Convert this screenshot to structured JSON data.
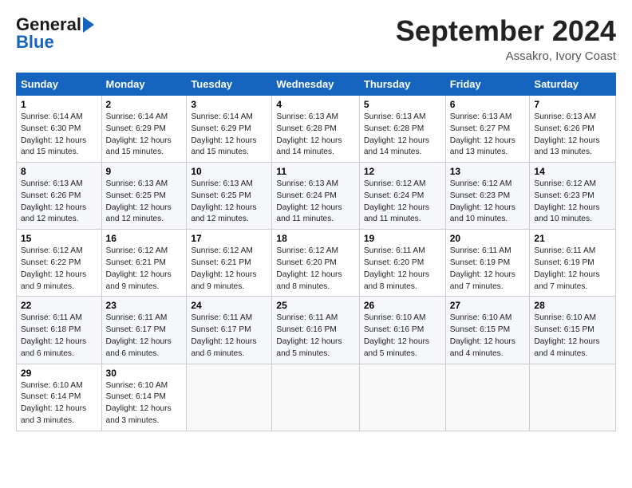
{
  "logo": {
    "line1": "General",
    "line2": "Blue",
    "arrow": true
  },
  "header": {
    "month": "September 2024",
    "location": "Assakro, Ivory Coast"
  },
  "days_of_week": [
    "Sunday",
    "Monday",
    "Tuesday",
    "Wednesday",
    "Thursday",
    "Friday",
    "Saturday"
  ],
  "weeks": [
    [
      {
        "day": "1",
        "sunrise": "6:14 AM",
        "sunset": "6:30 PM",
        "daylight": "12 hours and 15 minutes."
      },
      {
        "day": "2",
        "sunrise": "6:14 AM",
        "sunset": "6:29 PM",
        "daylight": "12 hours and 15 minutes."
      },
      {
        "day": "3",
        "sunrise": "6:14 AM",
        "sunset": "6:29 PM",
        "daylight": "12 hours and 15 minutes."
      },
      {
        "day": "4",
        "sunrise": "6:13 AM",
        "sunset": "6:28 PM",
        "daylight": "12 hours and 14 minutes."
      },
      {
        "day": "5",
        "sunrise": "6:13 AM",
        "sunset": "6:28 PM",
        "daylight": "12 hours and 14 minutes."
      },
      {
        "day": "6",
        "sunrise": "6:13 AM",
        "sunset": "6:27 PM",
        "daylight": "12 hours and 13 minutes."
      },
      {
        "day": "7",
        "sunrise": "6:13 AM",
        "sunset": "6:26 PM",
        "daylight": "12 hours and 13 minutes."
      }
    ],
    [
      {
        "day": "8",
        "sunrise": "6:13 AM",
        "sunset": "6:26 PM",
        "daylight": "12 hours and 12 minutes."
      },
      {
        "day": "9",
        "sunrise": "6:13 AM",
        "sunset": "6:25 PM",
        "daylight": "12 hours and 12 minutes."
      },
      {
        "day": "10",
        "sunrise": "6:13 AM",
        "sunset": "6:25 PM",
        "daylight": "12 hours and 12 minutes."
      },
      {
        "day": "11",
        "sunrise": "6:13 AM",
        "sunset": "6:24 PM",
        "daylight": "12 hours and 11 minutes."
      },
      {
        "day": "12",
        "sunrise": "6:12 AM",
        "sunset": "6:24 PM",
        "daylight": "12 hours and 11 minutes."
      },
      {
        "day": "13",
        "sunrise": "6:12 AM",
        "sunset": "6:23 PM",
        "daylight": "12 hours and 10 minutes."
      },
      {
        "day": "14",
        "sunrise": "6:12 AM",
        "sunset": "6:23 PM",
        "daylight": "12 hours and 10 minutes."
      }
    ],
    [
      {
        "day": "15",
        "sunrise": "6:12 AM",
        "sunset": "6:22 PM",
        "daylight": "12 hours and 9 minutes."
      },
      {
        "day": "16",
        "sunrise": "6:12 AM",
        "sunset": "6:21 PM",
        "daylight": "12 hours and 9 minutes."
      },
      {
        "day": "17",
        "sunrise": "6:12 AM",
        "sunset": "6:21 PM",
        "daylight": "12 hours and 9 minutes."
      },
      {
        "day": "18",
        "sunrise": "6:12 AM",
        "sunset": "6:20 PM",
        "daylight": "12 hours and 8 minutes."
      },
      {
        "day": "19",
        "sunrise": "6:11 AM",
        "sunset": "6:20 PM",
        "daylight": "12 hours and 8 minutes."
      },
      {
        "day": "20",
        "sunrise": "6:11 AM",
        "sunset": "6:19 PM",
        "daylight": "12 hours and 7 minutes."
      },
      {
        "day": "21",
        "sunrise": "6:11 AM",
        "sunset": "6:19 PM",
        "daylight": "12 hours and 7 minutes."
      }
    ],
    [
      {
        "day": "22",
        "sunrise": "6:11 AM",
        "sunset": "6:18 PM",
        "daylight": "12 hours and 6 minutes."
      },
      {
        "day": "23",
        "sunrise": "6:11 AM",
        "sunset": "6:17 PM",
        "daylight": "12 hours and 6 minutes."
      },
      {
        "day": "24",
        "sunrise": "6:11 AM",
        "sunset": "6:17 PM",
        "daylight": "12 hours and 6 minutes."
      },
      {
        "day": "25",
        "sunrise": "6:11 AM",
        "sunset": "6:16 PM",
        "daylight": "12 hours and 5 minutes."
      },
      {
        "day": "26",
        "sunrise": "6:10 AM",
        "sunset": "6:16 PM",
        "daylight": "12 hours and 5 minutes."
      },
      {
        "day": "27",
        "sunrise": "6:10 AM",
        "sunset": "6:15 PM",
        "daylight": "12 hours and 4 minutes."
      },
      {
        "day": "28",
        "sunrise": "6:10 AM",
        "sunset": "6:15 PM",
        "daylight": "12 hours and 4 minutes."
      }
    ],
    [
      {
        "day": "29",
        "sunrise": "6:10 AM",
        "sunset": "6:14 PM",
        "daylight": "12 hours and 3 minutes."
      },
      {
        "day": "30",
        "sunrise": "6:10 AM",
        "sunset": "6:14 PM",
        "daylight": "12 hours and 3 minutes."
      },
      null,
      null,
      null,
      null,
      null
    ]
  ]
}
